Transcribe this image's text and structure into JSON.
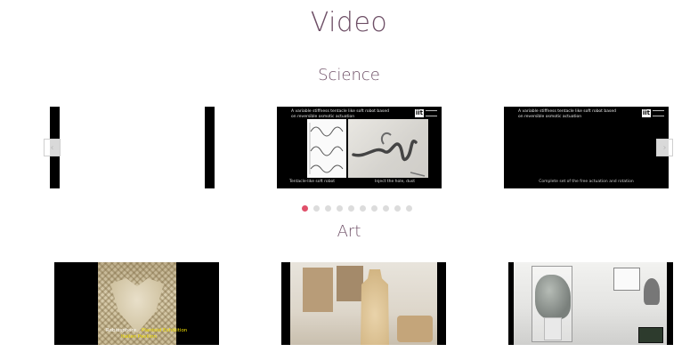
{
  "page": {
    "title": "Video"
  },
  "sections": {
    "science": {
      "title": "Science",
      "videos": [
        {
          "caption": "",
          "footer_left": "",
          "footer_right": ""
        },
        {
          "caption": "A variable stiffness tentacle like soft robot based on reversible osmotic actuation",
          "logo": "iit",
          "footer_left": "Tentacle-like soft robot",
          "footer_right": "Inject the hole, dust"
        },
        {
          "caption": "A variable stiffness tentacle like soft robot based on reversible osmotic actuation",
          "logo": "iit",
          "footer_center": "Complete set of the free actuation and rotation"
        }
      ]
    },
    "art": {
      "title": "Art",
      "videos": [
        {
          "subtitle_white": "Rebiosphere",
          "subtitle_yellow": "Plantoid Exhibition",
          "subtitle_yellow2": "Italian Pavilion"
        },
        {},
        {}
      ]
    }
  },
  "carousel": {
    "prev_glyph": "‹",
    "next_glyph": "›",
    "dot_count": 10,
    "active_dot": 0
  },
  "colors": {
    "heading": "#6e4f66",
    "active_dot": "#e0506a",
    "inactive_dot": "#dcdcdc"
  }
}
